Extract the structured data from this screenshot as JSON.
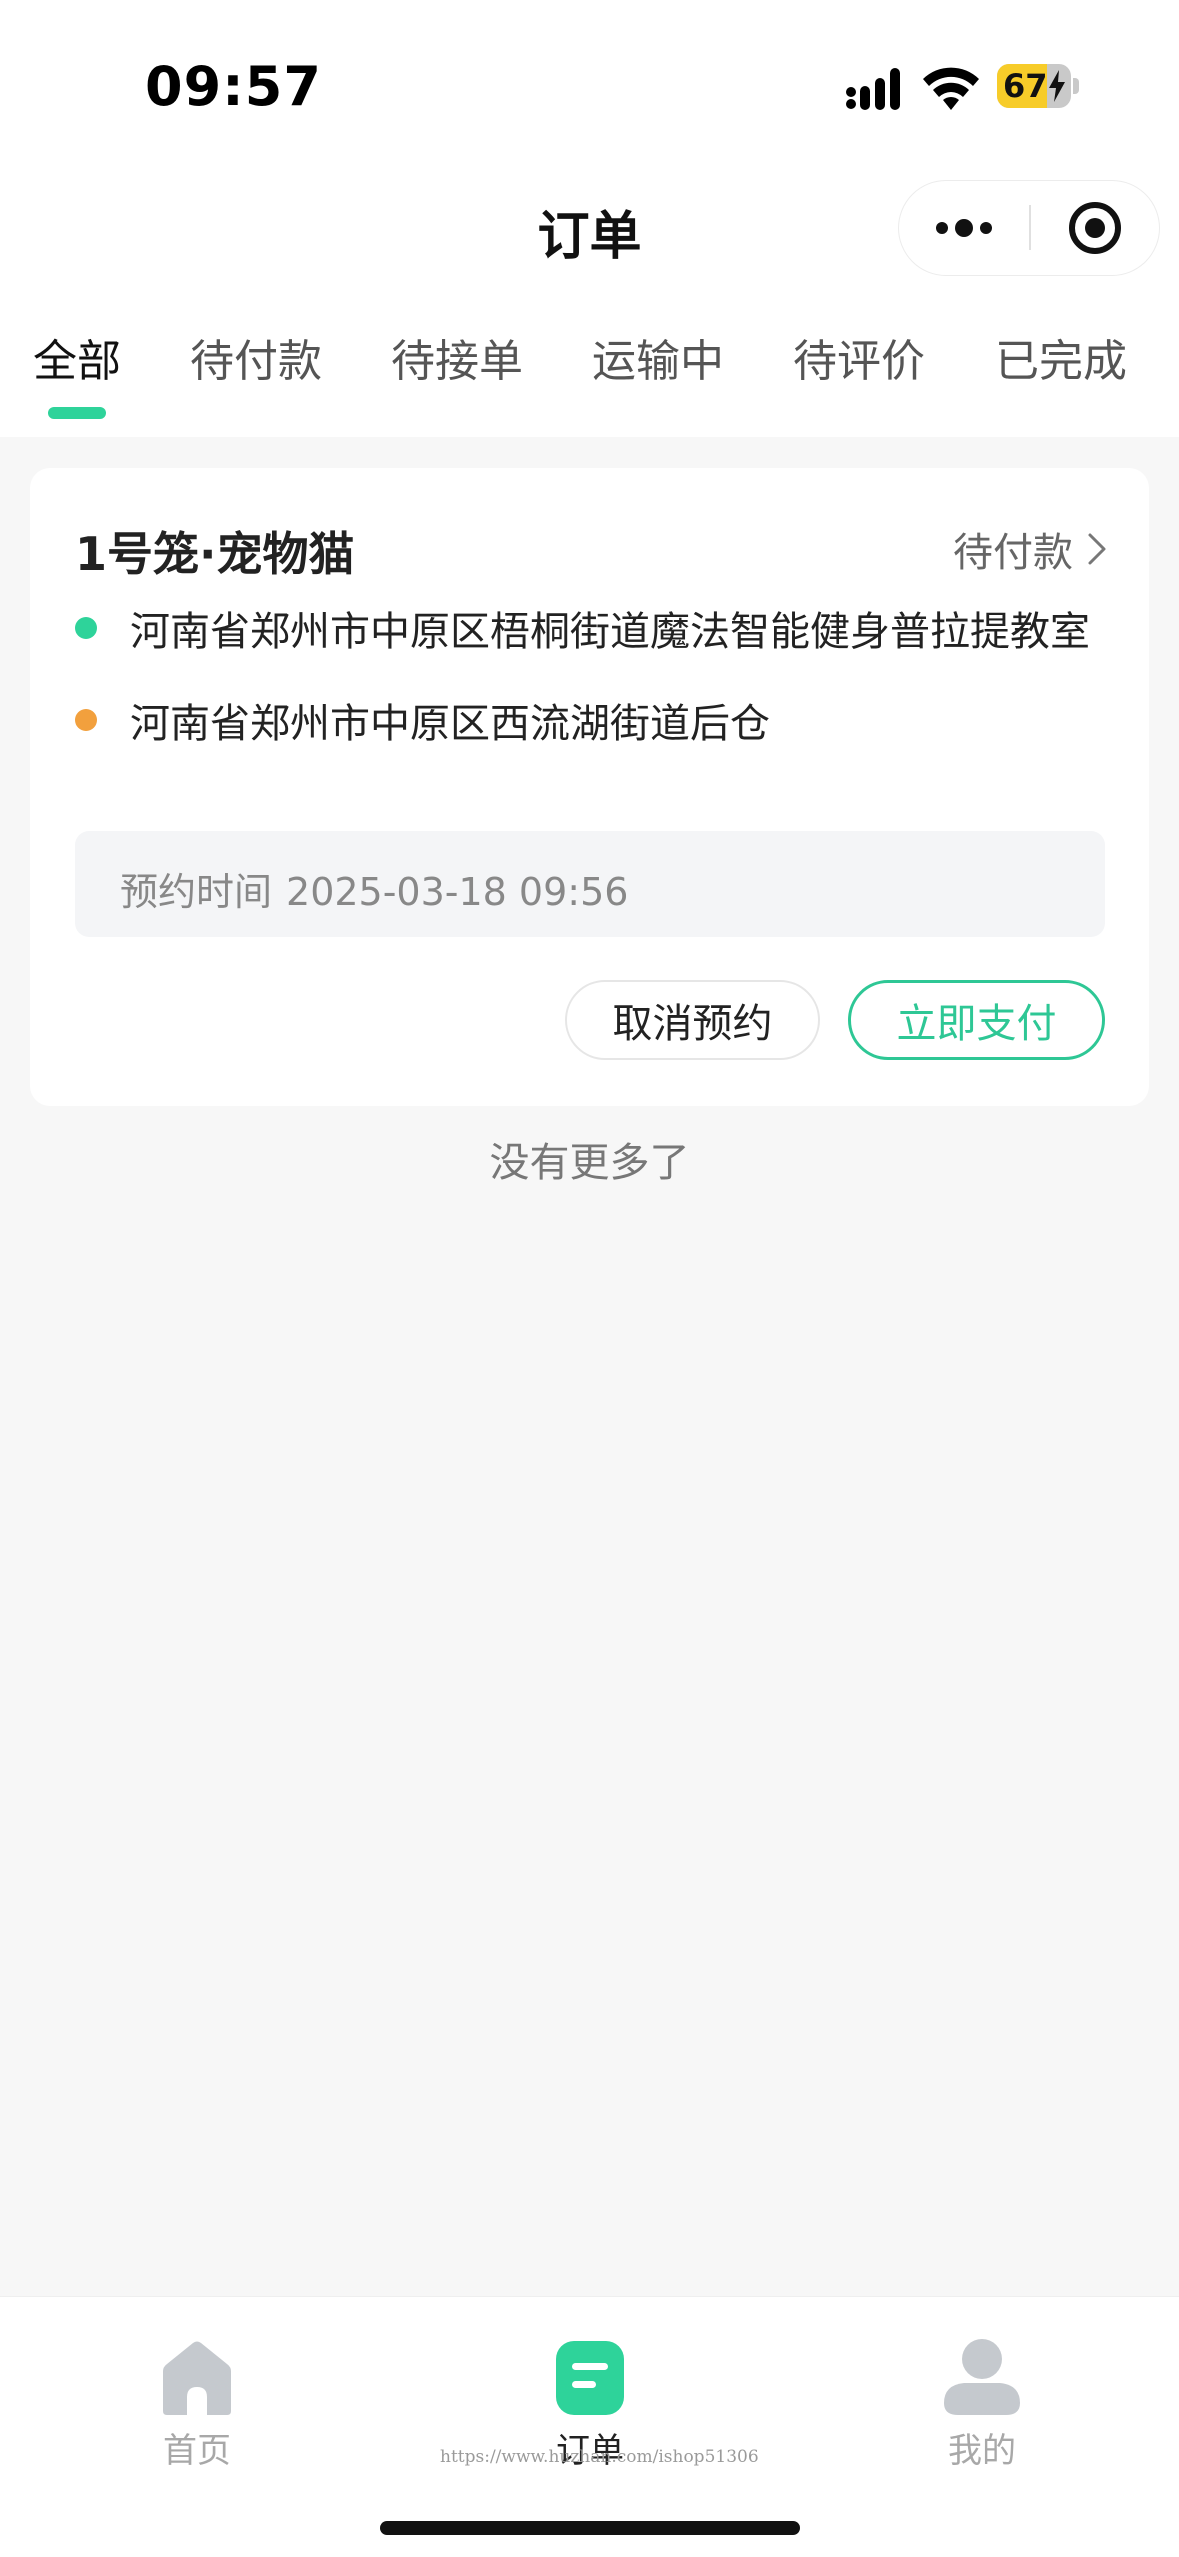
{
  "status_bar": {
    "time": "09:57",
    "battery_level": "67",
    "battery_fraction": 0.67
  },
  "header": {
    "title": "订单",
    "more_icon": "more-dots-icon",
    "target_icon": "target-circle-icon"
  },
  "tabs": [
    {
      "label": "全部",
      "active": true
    },
    {
      "label": "待付款",
      "active": false
    },
    {
      "label": "待接单",
      "active": false
    },
    {
      "label": "运输中",
      "active": false
    },
    {
      "label": "待评价",
      "active": false
    },
    {
      "label": "已完成",
      "active": false
    }
  ],
  "order": {
    "title": "1号笼·宠物猫",
    "status": "待付款",
    "from_address": "河南省郑州市中原区梧桐街道魔法智能健身普拉提教室",
    "to_address": "河南省郑州市中原区西流湖街道后仓",
    "reserve_label": "预约时间",
    "reserve_time": "2025-03-18 09:56",
    "cancel_label": "取消预约",
    "pay_label": "立即支付"
  },
  "list_end_text": "没有更多了",
  "bottom_nav": [
    {
      "label": "首页",
      "icon": "home-icon",
      "active": false
    },
    {
      "label": "订单",
      "icon": "order-icon",
      "active": true
    },
    {
      "label": "我的",
      "icon": "profile-icon",
      "active": false
    }
  ],
  "watermark": "https://www.huzhan.com/ishop51306",
  "colors": {
    "accent": "#2ED39A",
    "pay_green": "#2EC795",
    "from_dot": "#2ED39A",
    "to_dot": "#F2A03D",
    "battery": "#F7CC29"
  }
}
